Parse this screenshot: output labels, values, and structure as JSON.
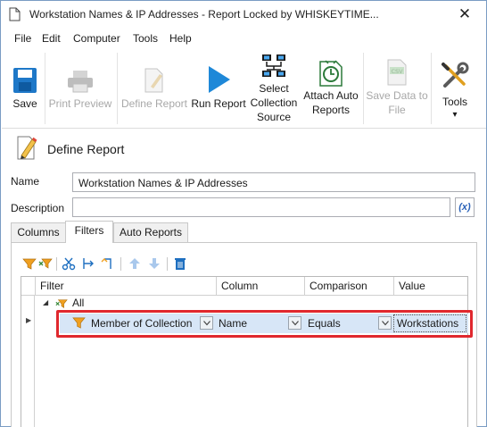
{
  "window": {
    "title": "Workstation Names & IP Addresses - Report Locked by WHISKEYTIME...",
    "close_glyph": "✕"
  },
  "menu": {
    "items": [
      "File",
      "Edit",
      "Computer",
      "Tools",
      "Help"
    ]
  },
  "toolbar": {
    "save": "Save",
    "print_preview": "Print Preview",
    "define_report": "Define Report",
    "run_report": "Run Report",
    "select_collection_source": [
      "Select",
      "Collection",
      "Source"
    ],
    "attach_auto_reports": [
      "Attach Auto",
      "Reports"
    ],
    "save_data_to_file": [
      "Save Data to",
      "File"
    ],
    "tools": "Tools",
    "tools_arrow": "▾",
    "csv_badge": "CSV"
  },
  "section": {
    "title": "Define Report"
  },
  "form": {
    "name_label": "Name",
    "name_value": "Workstation Names & IP Addresses",
    "description_label": "Description",
    "description_value": "",
    "expression_button": "(x)"
  },
  "tabs": [
    {
      "label": "Columns",
      "active": false
    },
    {
      "label": "Filters",
      "active": true
    },
    {
      "label": "Auto Reports",
      "active": false
    }
  ],
  "grid": {
    "headers": [
      "Filter",
      "Column",
      "Comparison",
      "Value"
    ],
    "root_node": "All",
    "row": {
      "filter": "Member of Collection",
      "column": "Name",
      "comparison": "Equals",
      "value": "Workstations"
    }
  },
  "colors": {
    "accent_blue": "#1e88d8",
    "highlight_red": "#e0282e",
    "row_selected": "#d7e6f7",
    "filter_orange": "#f0a020"
  }
}
